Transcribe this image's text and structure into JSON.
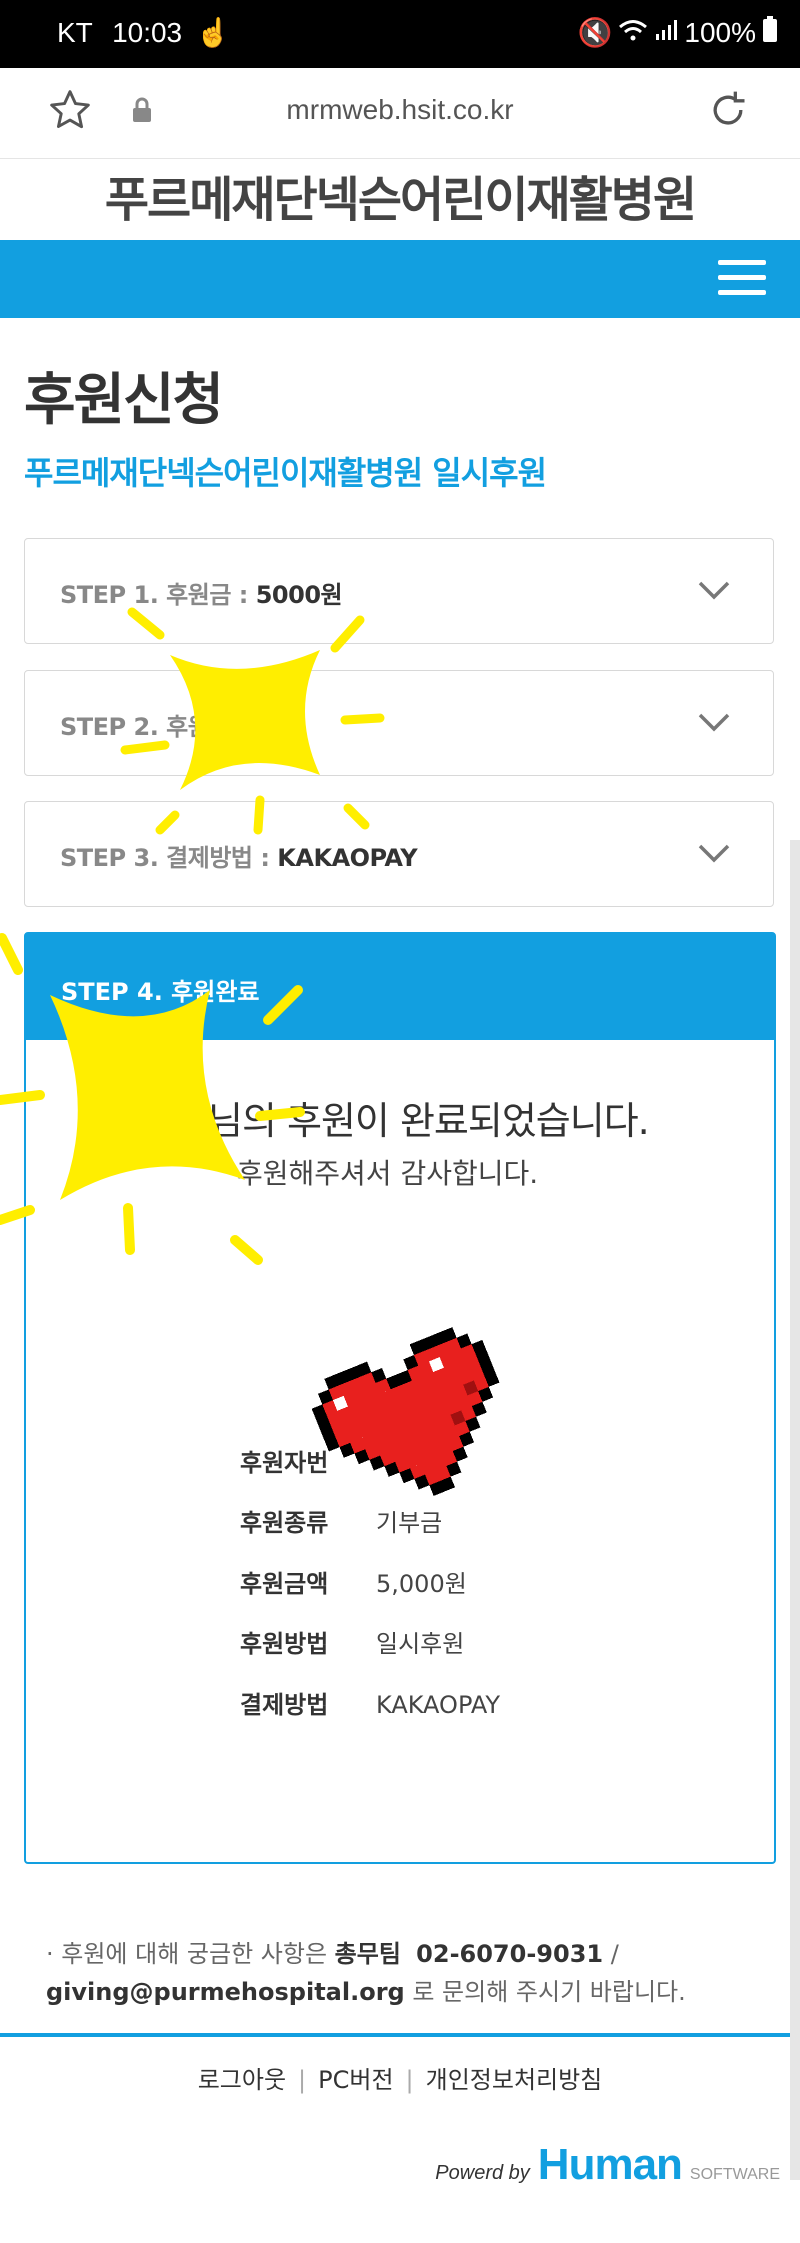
{
  "status_bar": {
    "carrier": "KT",
    "time": "10:03",
    "battery": "100%"
  },
  "browser": {
    "url": "mrmweb.hsit.co.kr"
  },
  "site": {
    "title": "푸르메재단넥슨어린이재활병원"
  },
  "page": {
    "heading": "후원신청",
    "subheading": "푸르메재단넥슨어린이재활병원 일시후원"
  },
  "steps": [
    {
      "label": "STEP 1. 후원금 : ",
      "value": "5000원"
    },
    {
      "label": "STEP 2. 후원자",
      "value": ""
    },
    {
      "label": "STEP 3. 결제방법 : ",
      "value": "KAKAOPAY"
    }
  ],
  "step4": {
    "header": "STEP 4. 후원완료",
    "message": "님의 후원이 완료되었습니다.",
    "thanks": "후원해주셔서 감사합니다.",
    "details": [
      {
        "key": "후원자번",
        "value": ""
      },
      {
        "key": "후원종류",
        "value": "기부금"
      },
      {
        "key": "후원금액",
        "value": "5,000원"
      },
      {
        "key": "후원방법",
        "value": "일시후원"
      },
      {
        "key": "결제방법",
        "value": "KAKAOPAY"
      }
    ]
  },
  "footer": {
    "note_prefix": "· 후원에 대해 궁금한 사항은 ",
    "team": "총무팀",
    "phone": "02-6070-9031",
    "slash": " / ",
    "email": "giving@purmehospital.org",
    "note_suffix": " 로 문의해 주시기 바랍니다.",
    "links": [
      "로그아웃",
      "PC버전",
      "개인정보처리방침"
    ],
    "powered_by": "Powerd by",
    "brand": "Human",
    "brand_suffix": "SOFTWARE"
  },
  "colors": {
    "accent": "#129fe0",
    "highlight": "#ffee00",
    "heart": "#e8201e"
  }
}
